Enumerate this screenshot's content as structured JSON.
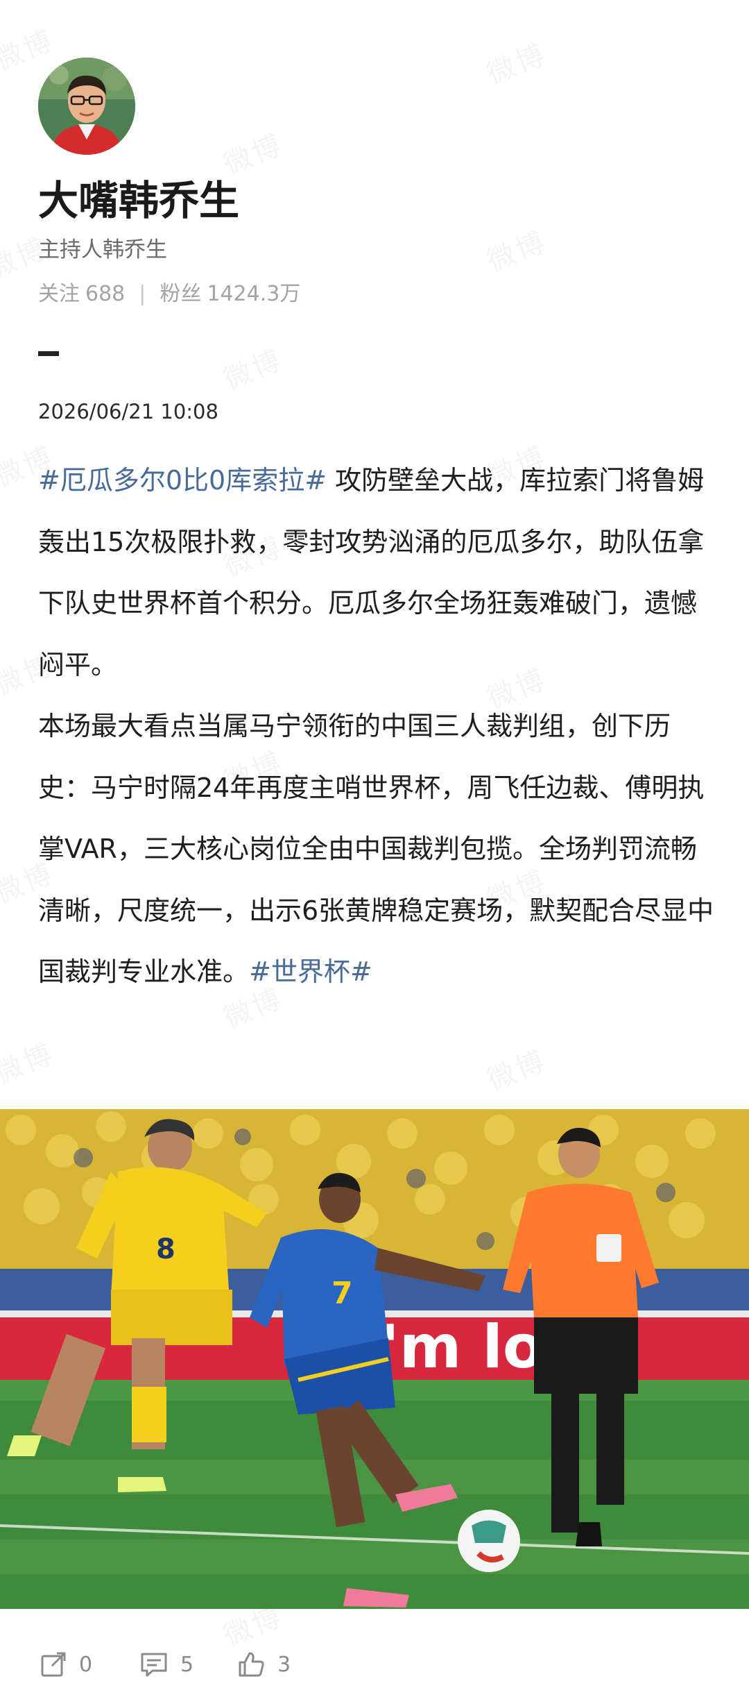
{
  "profile": {
    "name": "大嘴韩乔生",
    "bio": "主持人韩乔生",
    "following_label": "关注",
    "following_count": "688",
    "followers_label": "粉丝",
    "followers_count": "1424.3万",
    "avatar_icon": "avatar-photo"
  },
  "post": {
    "timestamp": "2026/06/21 10:08",
    "paragraph1": {
      "hashtag": "#厄瓜多尔0比0库索拉#",
      "text": " 攻防壁垒大战，库拉索门将鲁姆轰出15次极限扑救，零封攻势汹涌的厄瓜多尔，助队伍拿下队史世界杯首个积分。厄瓜多尔全场狂轰难破门，遗憾闷平。"
    },
    "paragraph2": {
      "text": "本场最大看点当属马宁领衔的中国三人裁判组，创下历史：马宁时隔24年再度主哨世界杯，周飞任边裁、傅明执掌VAR，三大核心岗位全由中国裁判包揽。全场判罚流畅清晰，尺度统一，出示6张黄牌稳定赛场，默契配合尽显中国裁判专业水准。",
      "hashtag": "#世界杯#"
    },
    "image": {
      "banner_text": "i'm lov",
      "player1_number": "8",
      "player2_number": "7"
    }
  },
  "actions": {
    "repost_count": "0",
    "comment_count": "5",
    "like_count": "3"
  },
  "watermark": "微博",
  "colors": {
    "hashtag": "#476a98",
    "text": "#1e1e1e",
    "muted": "#a3a3a3"
  }
}
